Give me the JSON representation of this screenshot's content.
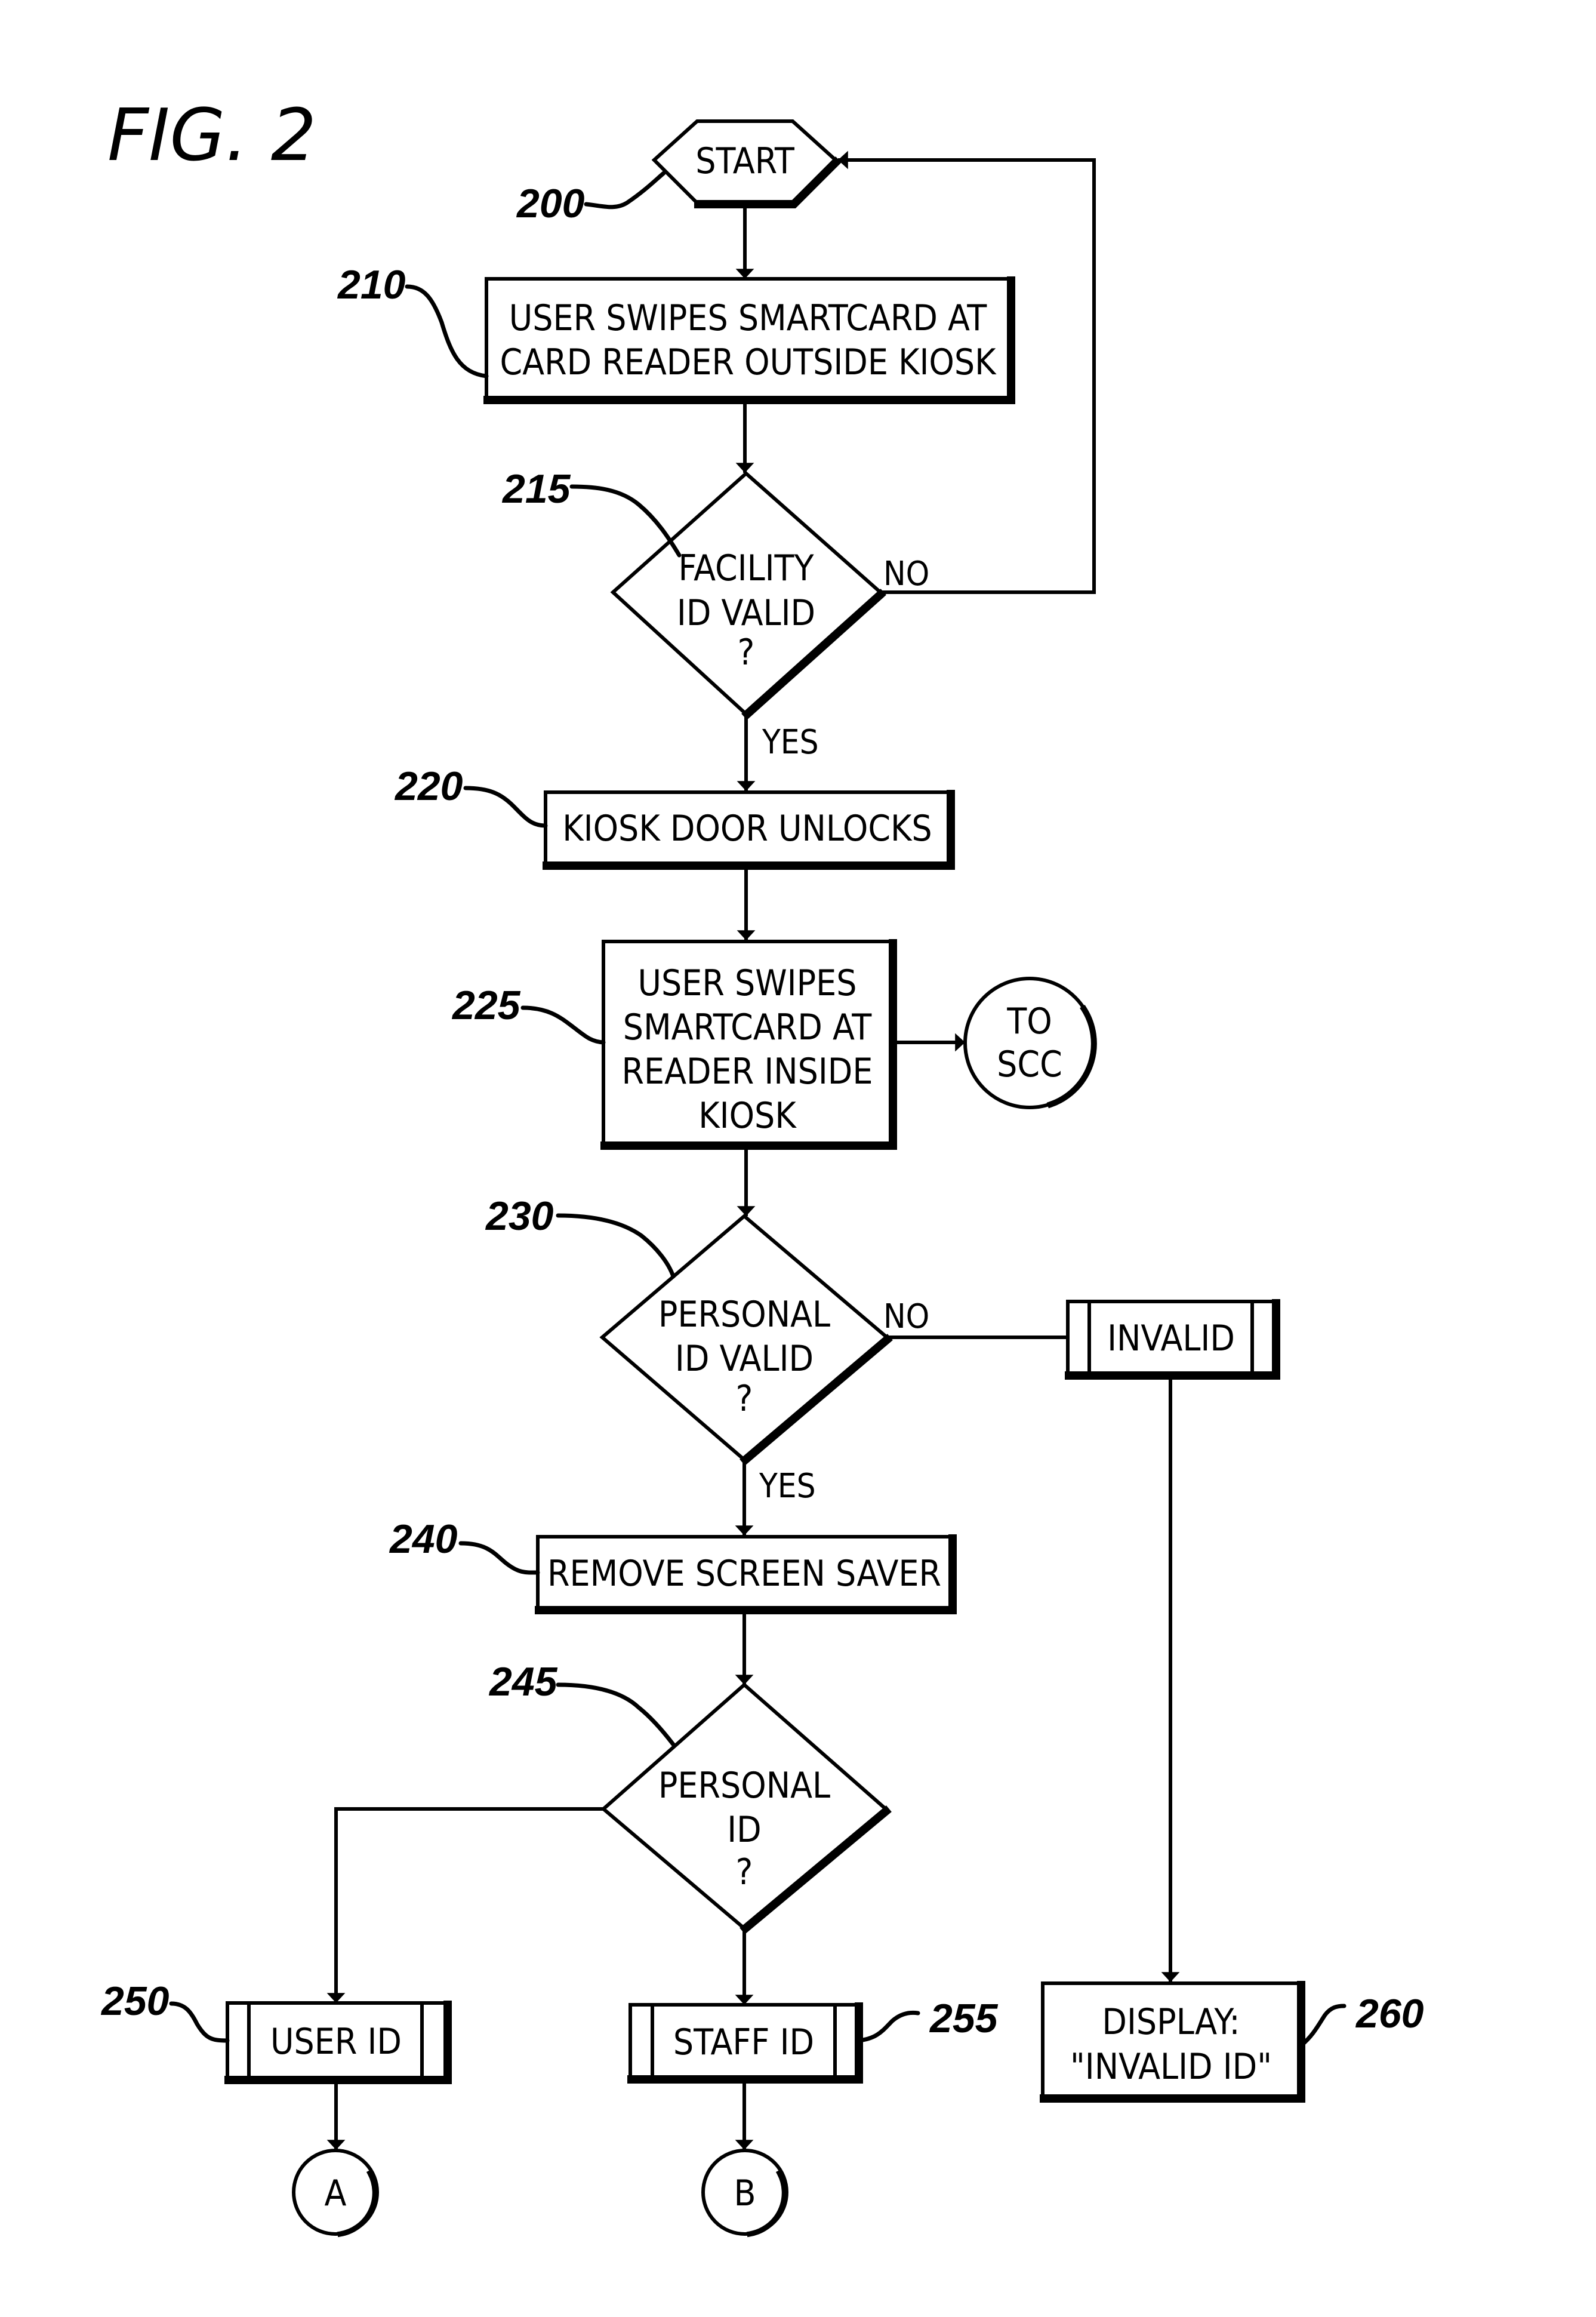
{
  "figure": {
    "title": "FIG. 2"
  },
  "nodes": {
    "n200": {
      "ref": "200",
      "type": "terminal",
      "lines": [
        "START"
      ]
    },
    "n210": {
      "ref": "210",
      "type": "process",
      "lines": [
        "USER SWIPES SMARTCARD AT",
        "CARD READER OUTSIDE KIOSK"
      ]
    },
    "n215": {
      "ref": "215",
      "type": "decision",
      "lines": [
        "FACILITY",
        "ID VALID",
        "?"
      ]
    },
    "n220": {
      "ref": "220",
      "type": "process",
      "lines": [
        "KIOSK DOOR UNLOCKS"
      ]
    },
    "n225": {
      "ref": "225",
      "type": "process",
      "lines": [
        "USER SWIPES",
        "SMARTCARD AT",
        "READER INSIDE",
        "KIOSK"
      ]
    },
    "scc": {
      "type": "connector",
      "lines": [
        "TO",
        "SCC"
      ]
    },
    "n230": {
      "ref": "230",
      "type": "decision",
      "lines": [
        "PERSONAL",
        "ID VALID",
        "?"
      ]
    },
    "invalid": {
      "type": "predefined-process",
      "lines": [
        "INVALID"
      ]
    },
    "n240": {
      "ref": "240",
      "type": "process",
      "lines": [
        "REMOVE SCREEN SAVER"
      ]
    },
    "n245": {
      "ref": "245",
      "type": "decision",
      "lines": [
        "PERSONAL",
        "ID",
        "?"
      ]
    },
    "n250": {
      "ref": "250",
      "type": "predefined-process",
      "lines": [
        "USER ID"
      ]
    },
    "n255": {
      "ref": "255",
      "type": "predefined-process",
      "lines": [
        "STAFF ID"
      ]
    },
    "n260": {
      "ref": "260",
      "type": "process",
      "lines": [
        "DISPLAY:",
        "\"INVALID ID\""
      ]
    },
    "connA": {
      "type": "connector",
      "lines": [
        "A"
      ]
    },
    "connB": {
      "type": "connector",
      "lines": [
        "B"
      ]
    }
  },
  "branches": {
    "b215_no": "NO",
    "b215_yes": "YES",
    "b230_no": "NO",
    "b230_yes": "YES"
  },
  "edges": [
    {
      "from": "n200",
      "to": "n210"
    },
    {
      "from": "n210",
      "to": "n215"
    },
    {
      "from": "n215",
      "to": "n200",
      "label": "NO"
    },
    {
      "from": "n215",
      "to": "n220",
      "label": "YES"
    },
    {
      "from": "n220",
      "to": "n225"
    },
    {
      "from": "n225",
      "to": "scc"
    },
    {
      "from": "n225",
      "to": "n230"
    },
    {
      "from": "n230",
      "to": "invalid",
      "label": "NO"
    },
    {
      "from": "n230",
      "to": "n240",
      "label": "YES"
    },
    {
      "from": "invalid",
      "to": "n260"
    },
    {
      "from": "n240",
      "to": "n245"
    },
    {
      "from": "n245",
      "to": "n250"
    },
    {
      "from": "n245",
      "to": "n255"
    },
    {
      "from": "n250",
      "to": "connA"
    },
    {
      "from": "n255",
      "to": "connB"
    }
  ],
  "colors": {
    "ink": "#000000",
    "paper": "#ffffff"
  }
}
